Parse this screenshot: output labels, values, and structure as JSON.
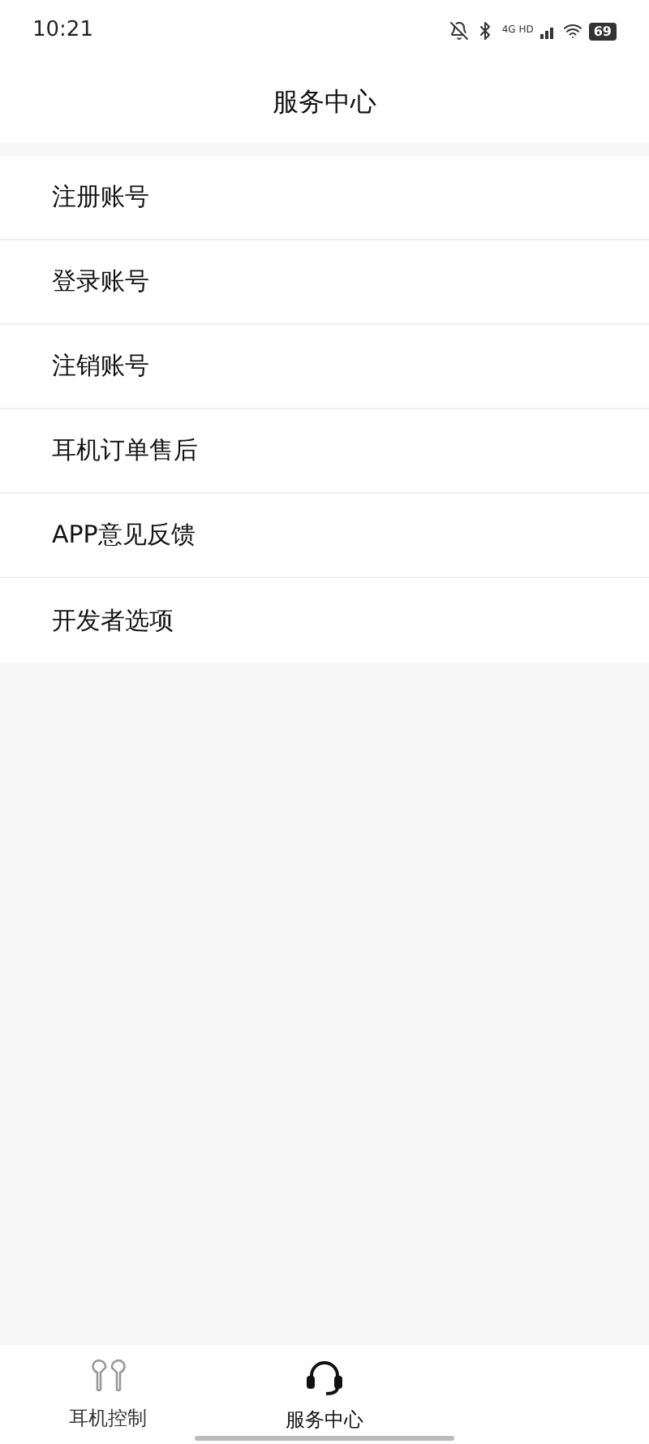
{
  "status_bar": {
    "time": "10:21",
    "network": "4G HD",
    "battery": "69"
  },
  "header": {
    "title": "服务中心"
  },
  "menu": [
    {
      "label": "注册账号"
    },
    {
      "label": "登录账号"
    },
    {
      "label": "注销账号"
    },
    {
      "label": "耳机订单售后"
    },
    {
      "label": "APP意见反馈"
    },
    {
      "label": "开发者选项"
    }
  ],
  "tabs": [
    {
      "label": "耳机控制",
      "kind": "earbuds",
      "selected": false
    },
    {
      "label": "服务中心",
      "kind": "headset",
      "selected": true
    }
  ]
}
